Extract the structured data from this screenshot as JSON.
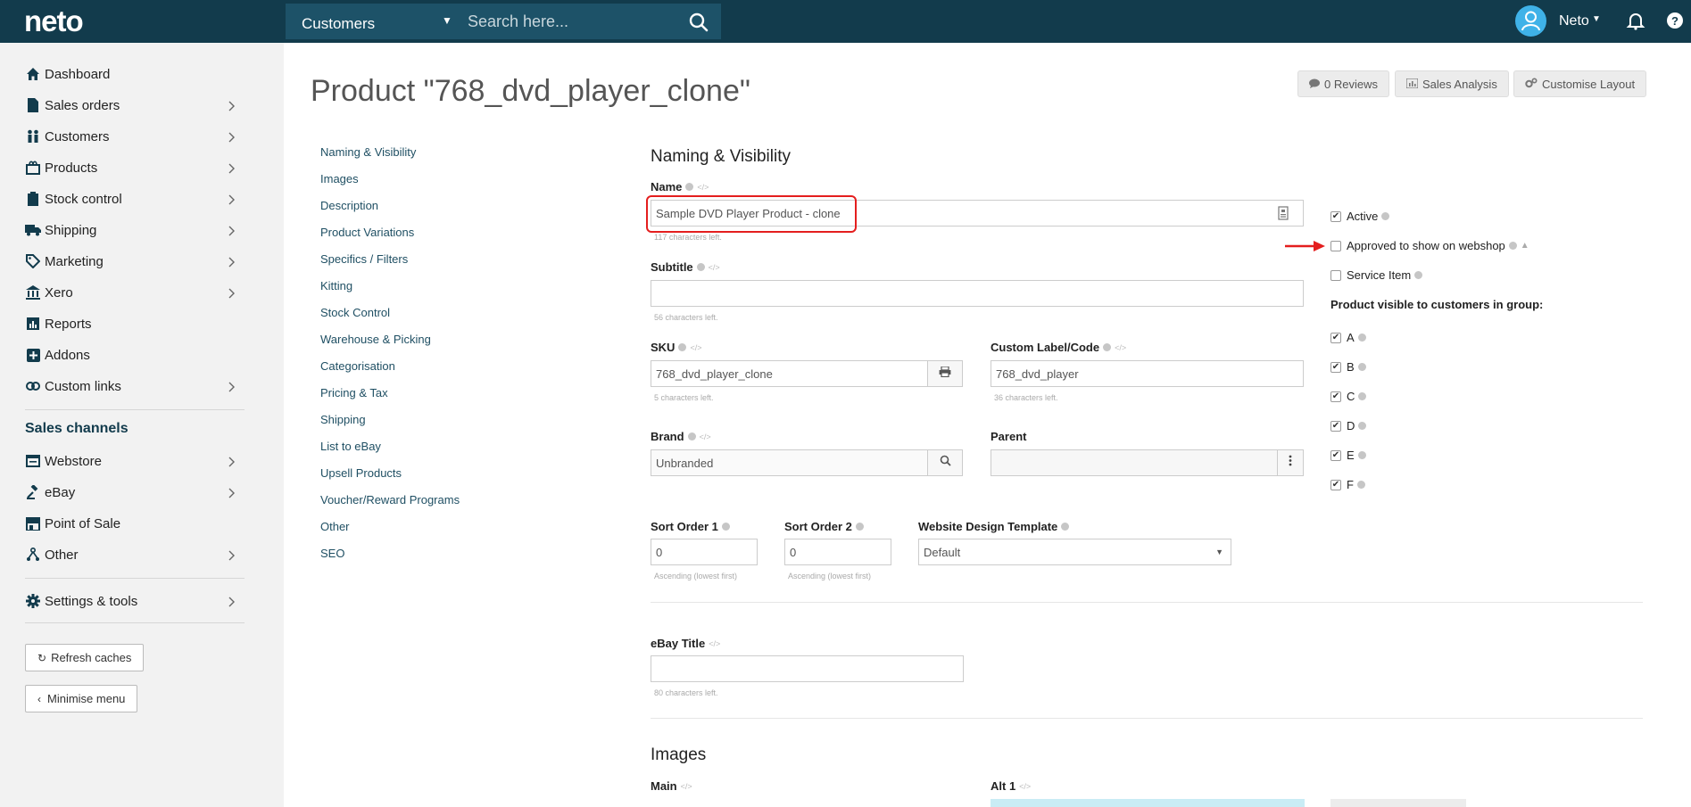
{
  "topbar": {
    "logo": "neto",
    "search_scope": "Customers",
    "search_placeholder": "Search here...",
    "user_name": "Neto"
  },
  "sidebar": {
    "items": [
      {
        "label": "Dashboard",
        "icon": "home-icon"
      },
      {
        "label": "Sales orders",
        "icon": "document-icon"
      },
      {
        "label": "Customers",
        "icon": "users-icon"
      },
      {
        "label": "Products",
        "icon": "box-icon"
      },
      {
        "label": "Stock control",
        "icon": "clipboard-icon"
      },
      {
        "label": "Shipping",
        "icon": "truck-icon"
      },
      {
        "label": "Marketing",
        "icon": "tag-icon"
      },
      {
        "label": "Xero",
        "icon": "bank-icon"
      },
      {
        "label": "Reports",
        "icon": "bar-chart-icon"
      },
      {
        "label": "Addons",
        "icon": "plus-square-icon"
      },
      {
        "label": "Custom links",
        "icon": "link-icon"
      }
    ],
    "sales_channels_heading": "Sales channels",
    "channels": [
      {
        "label": "Webstore",
        "icon": "window-icon"
      },
      {
        "label": "eBay",
        "icon": "gavel-icon"
      },
      {
        "label": "Point of Sale",
        "icon": "store-icon"
      },
      {
        "label": "Other",
        "icon": "sitemap-icon"
      }
    ],
    "settings": {
      "label": "Settings & tools",
      "icon": "gear-icon"
    },
    "refresh_caches": "Refresh caches",
    "minimise_menu": "Minimise menu"
  },
  "page": {
    "title": "Product \"768_dvd_player_clone\"",
    "buttons": {
      "reviews": "0 Reviews",
      "sales_analysis": "Sales Analysis",
      "customise_layout": "Customise Layout"
    },
    "section_links": [
      "Naming & Visibility",
      "Images",
      "Description",
      "Product Variations",
      "Specifics / Filters",
      "Kitting",
      "Stock Control",
      "Warehouse & Picking",
      "Categorisation",
      "Pricing & Tax",
      "Shipping",
      "List to eBay",
      "Upsell Products",
      "Voucher/Reward Programs",
      "Other",
      "SEO"
    ]
  },
  "form": {
    "section_title": "Naming & Visibility",
    "name_label": "Name",
    "name_value": "Sample DVD Player Product - clone",
    "name_hint": "117 characters left.",
    "subtitle_label": "Subtitle",
    "subtitle_value": "",
    "subtitle_hint": "56 characters left.",
    "sku_label": "SKU",
    "sku_value": "768_dvd_player_clone",
    "sku_hint": "5 characters left.",
    "custom_label_label": "Custom Label/Code",
    "custom_label_value": "768_dvd_player",
    "custom_label_hint": "36 characters left.",
    "brand_label": "Brand",
    "brand_value": "Unbranded",
    "parent_label": "Parent",
    "parent_value": "",
    "sort1_label": "Sort Order 1",
    "sort1_value": "0",
    "sort1_hint": "Ascending (lowest first)",
    "sort2_label": "Sort Order 2",
    "sort2_value": "0",
    "sort2_hint": "Ascending (lowest first)",
    "template_label": "Website Design Template",
    "template_value": "Default",
    "ebay_title_label": "eBay Title",
    "ebay_title_value": "",
    "ebay_title_hint": "80 characters left.",
    "images_title": "Images",
    "main_label": "Main",
    "alt1_label": "Alt 1"
  },
  "visibility": {
    "active": {
      "label": "Active",
      "checked": true
    },
    "approved": {
      "label": "Approved to show on webshop",
      "checked": false
    },
    "service_item": {
      "label": "Service Item",
      "checked": false
    },
    "groups_heading": "Product visible to customers in group:",
    "groups": [
      {
        "label": "A",
        "checked": true
      },
      {
        "label": "B",
        "checked": true
      },
      {
        "label": "C",
        "checked": true
      },
      {
        "label": "D",
        "checked": true
      },
      {
        "label": "E",
        "checked": true
      },
      {
        "label": "F",
        "checked": true
      }
    ]
  },
  "colors": {
    "topbar": "#123b4c",
    "search_bg": "#1d5268",
    "avatar": "#3fb2e8",
    "highlight": "#e41e1e"
  }
}
